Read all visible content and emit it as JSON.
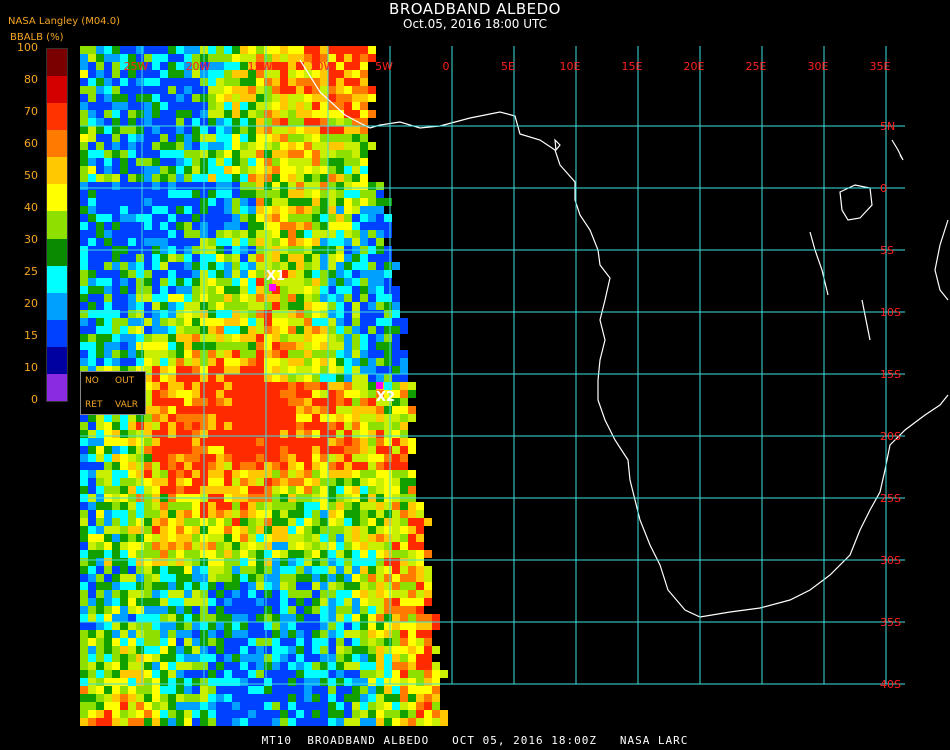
{
  "header": {
    "title": "BROADBAND ALBEDO",
    "datetime": "Oct.05, 2016 18:00 UTC",
    "source": "NASA Langley (M04.0)",
    "units_label": "BBALB (%)"
  },
  "colorbar": {
    "ticks": [
      "100",
      "80",
      "70",
      "60",
      "50",
      "40",
      "30",
      "25",
      "20",
      "15",
      "10",
      "0"
    ],
    "colors": [
      "#7a0000",
      "#d40000",
      "#ff3300",
      "#ff7a00",
      "#ffc800",
      "#ffff00",
      "#8ee000",
      "#0a8a00",
      "#00ffff",
      "#00a0ff",
      "#0040ff",
      "#0000a0",
      "#8a2be2"
    ]
  },
  "legend_box": {
    "no": "NO",
    "out": "OUT",
    "ret": "RET",
    "valr": "VALR"
  },
  "grid": {
    "lon_labels": [
      "25W",
      "20W",
      "15W",
      "10W",
      "5W",
      "0",
      "5E",
      "10E",
      "15E",
      "20E",
      "25E",
      "30E",
      "35E"
    ],
    "lat_labels": [
      "5N",
      "0",
      "5S",
      "10S",
      "15S",
      "20S",
      "25S",
      "30S",
      "35S",
      "40S"
    ],
    "line_color": "#40e0e0",
    "label_color": "#ff2020"
  },
  "markers": [
    {
      "label": "X1",
      "color": "#ff00ff"
    },
    {
      "label": "X2",
      "color": "#ff00ff"
    }
  ],
  "footer": "MT10  BROADBAND ALBEDO   OCT 05, 2016 18:00Z   NASA LARC"
}
